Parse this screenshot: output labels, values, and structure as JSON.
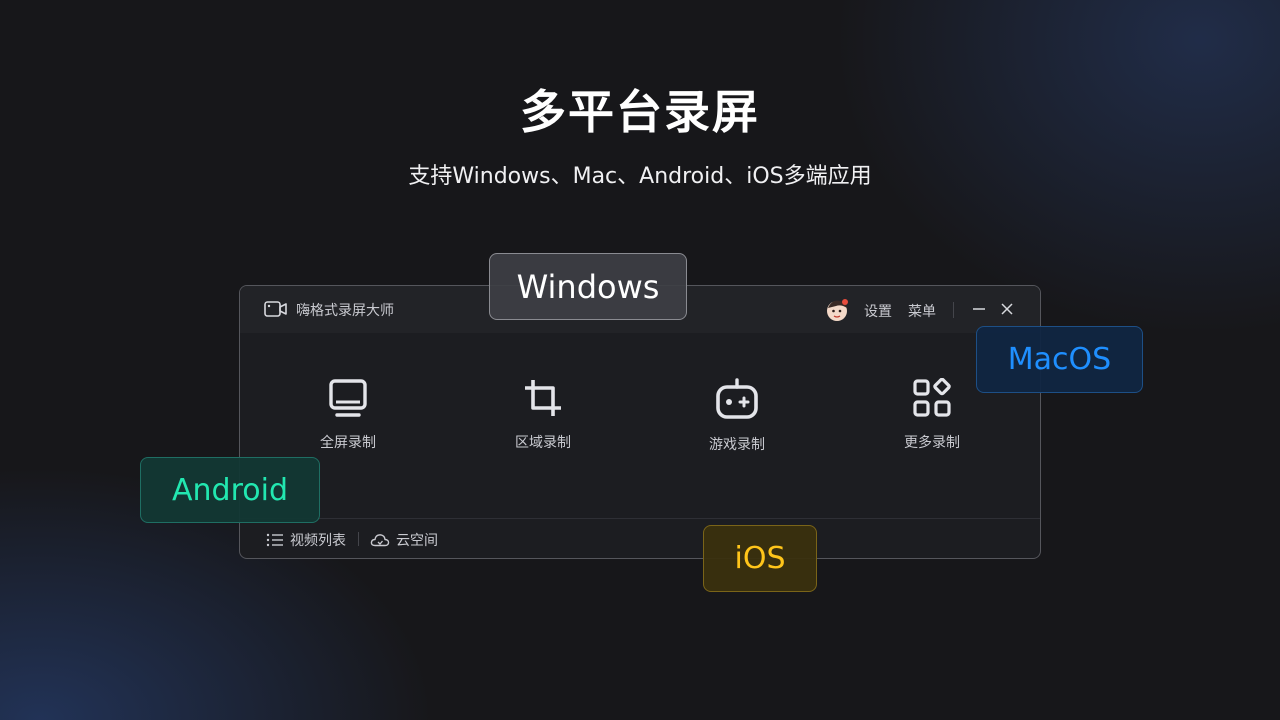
{
  "hero": {
    "title": "多平台录屏",
    "subtitle": "支持Windows、Mac、Android、iOS多端应用"
  },
  "app": {
    "name": "嗨格式录屏大师",
    "logo_icon": "video-camera-icon",
    "titlebar": {
      "avatar_icon": "cartoon-avatar-icon",
      "settings_label": "设置",
      "menu_label": "菜单",
      "minimize_icon": "minimize-icon",
      "close_icon": "close-icon"
    },
    "modes": [
      {
        "label": "全屏录制",
        "icon": "monitor-icon"
      },
      {
        "label": "区域录制",
        "icon": "crop-icon"
      },
      {
        "label": "游戏录制",
        "icon": "gamepad-icon"
      },
      {
        "label": "更多录制",
        "icon": "apps-grid-icon"
      }
    ],
    "footer": {
      "video_list_label": "视频列表",
      "video_list_icon": "list-icon",
      "cloud_label": "云空间",
      "cloud_icon": "cloud-icon"
    }
  },
  "platform_tags": {
    "windows": {
      "label": "Windows",
      "color": "#ffffff"
    },
    "macos": {
      "label": "MacOS",
      "color": "#1f8fff"
    },
    "android": {
      "label": "Android",
      "color": "#22e7b0"
    },
    "ios": {
      "label": "iOS",
      "color": "#ffc51a"
    }
  },
  "colors": {
    "background": "#17171a",
    "window_bg": "#1c1d21",
    "titlebar_bg": "#222327"
  }
}
